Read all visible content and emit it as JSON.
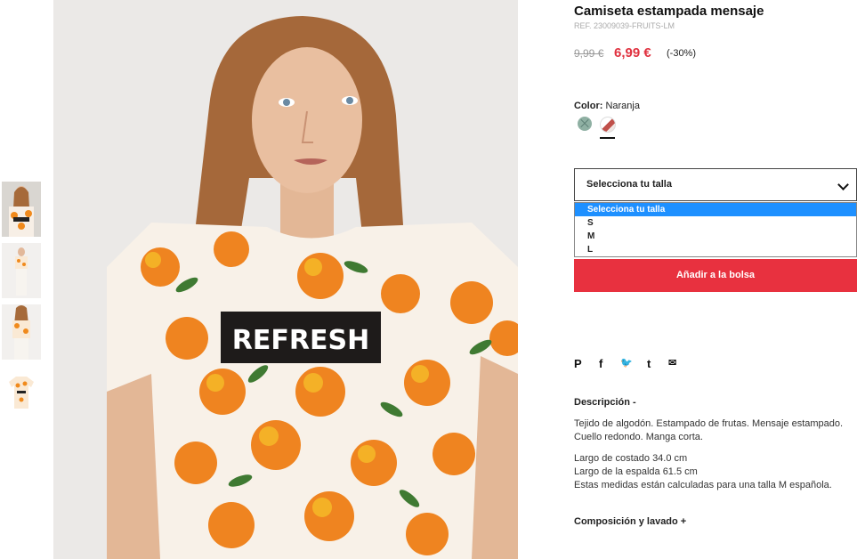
{
  "product": {
    "title": "Camiseta estampada mensaje",
    "ref": "REF. 23009039-FRUITS-LM",
    "old_price": "9,99 €",
    "new_price": "6,99 €",
    "discount": "(-30%)"
  },
  "color": {
    "label": "Color:",
    "value": "Naranja",
    "swatches": [
      "green-swatch",
      "print-swatch"
    ]
  },
  "size": {
    "placeholder": "Selecciona tu talla",
    "options": [
      "Selecciona tu talla",
      "S",
      "M",
      "L"
    ],
    "selected_index": 0
  },
  "add_button": "Añadir a la bolsa",
  "share_icons": [
    "pinterest-icon",
    "facebook-icon",
    "twitter-icon",
    "tumblr-icon",
    "email-icon"
  ],
  "share_glyphs": [
    "P",
    "f",
    "🐦",
    "t",
    "✉"
  ],
  "description": {
    "heading": "Descripción -",
    "line1": "Tejido de algodón. Estampado de frutas. Mensaje estampado. Cuello redondo. Manga corta.",
    "line2": "Largo de costado 34.0 cm",
    "line3": "Largo de la espalda 61.5 cm",
    "line4": "Estas medidas están calculadas para una talla M española."
  },
  "composition_heading": "Composición y lavado +",
  "main_image_text": "REFRESH",
  "colors": {
    "accent": "#e8313f",
    "price": "#e0313f",
    "select_highlight": "#1e90ff"
  }
}
